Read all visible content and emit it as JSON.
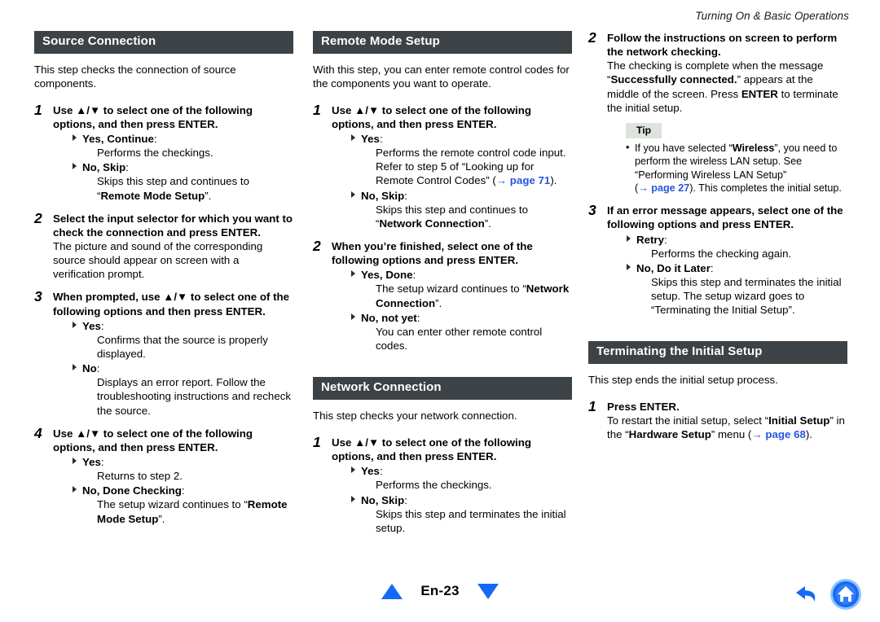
{
  "running_head": "Turning On & Basic Operations",
  "columns": [
    {
      "id": "column-1",
      "sections": [
        {
          "heading": "Source Connection",
          "intro": "This step checks the connection of source components.",
          "steps": [
            {
              "num": "1",
              "title": "Use ▲/▼ to select one of the following options, and then press ENTER.",
              "options": [
                {
                  "label": "Yes, Continue",
                  "desc": "Performs the checkings."
                },
                {
                  "label": "No, Skip",
                  "desc_pre": "Skips this step and continues to “",
                  "desc_bold": "Remote Mode Setup",
                  "desc_post": "”."
                }
              ]
            },
            {
              "num": "2",
              "title": "Select the input selector for which you want to check the connection and press ENTER.",
              "body": "The picture and sound of the corresponding source should appear on screen with a verification prompt."
            },
            {
              "num": "3",
              "title": "When prompted, use ▲/▼ to select one of the following options and then press ENTER.",
              "options": [
                {
                  "label": "Yes",
                  "desc": "Confirms that the source is properly displayed."
                },
                {
                  "label": "No",
                  "desc": "Displays an error report. Follow the troubleshooting instructions and recheck the source."
                }
              ]
            },
            {
              "num": "4",
              "title": "Use ▲/▼ to select one of the following options, and then press ENTER.",
              "options": [
                {
                  "label": "Yes",
                  "desc": "Returns to step 2."
                },
                {
                  "label": "No, Done Checking",
                  "desc_pre": "The setup wizard continues to “",
                  "desc_bold": "Remote Mode Setup",
                  "desc_post": "”."
                }
              ]
            }
          ]
        }
      ]
    },
    {
      "id": "column-2",
      "sections": [
        {
          "heading": "Remote Mode Setup",
          "intro": "With this step, you can enter remote control codes for the components you want to operate.",
          "steps": [
            {
              "num": "1",
              "title": "Use ▲/▼ to select one of the following options, and then press ENTER.",
              "options": [
                {
                  "label": "Yes",
                  "desc_pre": "Performs the remote control code input. Refer to step 5 of “Looking up for Remote Control Codes” (",
                  "link": "→ page 71",
                  "desc_post": ")."
                },
                {
                  "label": "No, Skip",
                  "desc_pre": "Skips this step and continues to “",
                  "desc_bold": "Network Connection",
                  "desc_post": "”."
                }
              ]
            },
            {
              "num": "2",
              "title": "When you’re finished, select one of the following options and press ENTER.",
              "options": [
                {
                  "label": "Yes, Done",
                  "desc_pre": "The setup wizard continues to “",
                  "desc_bold": "Network Connection",
                  "desc_post": "”."
                },
                {
                  "label": "No, not yet",
                  "desc": "You can enter other remote control codes."
                }
              ]
            }
          ]
        },
        {
          "heading": "Network Connection",
          "intro": "This step checks your network connection.",
          "steps": [
            {
              "num": "1",
              "title": "Use ▲/▼ to select one of the following options, and then press ENTER.",
              "options": [
                {
                  "label": "Yes",
                  "desc": "Performs the checkings."
                },
                {
                  "label": "No, Skip",
                  "desc": "Skips this step and terminates the initial setup."
                }
              ]
            }
          ]
        }
      ]
    },
    {
      "id": "column-3",
      "sections": [
        {
          "heading": null,
          "steps": [
            {
              "num": "2",
              "title": "Follow the instructions on screen to perform the network checking.",
              "body_pre": "The checking is complete when the message “",
              "body_bold_1": "Successfully connected.",
              "body_mid": "” appears at the middle of the screen. Press ",
              "body_bold_2": "ENTER",
              "body_post": " to terminate the initial setup.",
              "tip": {
                "badge": "Tip",
                "text_pre": "If you have selected “",
                "text_bold": "Wireless",
                "text_mid": "”, you need to perform the wireless LAN setup. See “Performing Wireless LAN Setup” (",
                "link": "→ page 27",
                "text_post": "). This completes the initial setup."
              }
            },
            {
              "num": "3",
              "title": "If an error message appears, select one of the following options and press ENTER.",
              "options": [
                {
                  "label": "Retry",
                  "desc": "Performs the checking again."
                },
                {
                  "label": "No, Do it Later",
                  "desc": "Skips this step and terminates the initial setup. The setup wizard goes to “Terminating the Initial Setup”."
                }
              ]
            }
          ]
        },
        {
          "heading": "Terminating the Initial Setup",
          "intro": "This step ends the initial setup process.",
          "steps": [
            {
              "num": "1",
              "title": "Press ENTER.",
              "body_pre": "To restart the initial setup, select “",
              "body_bold_1": "Initial Setup",
              "body_mid": "” in the “",
              "body_bold_2": "Hardware Setup",
              "body_mid_2": "” menu (",
              "link": "→ page 68",
              "body_post": ")."
            }
          ]
        }
      ]
    }
  ],
  "footer": {
    "page_label": "En-23",
    "prev_page_icon": "triangle-up-icon",
    "next_page_icon": "triangle-down-icon",
    "back_icon": "back-arrow-icon",
    "home_icon": "home-icon"
  },
  "colors": {
    "section_bar_bg": "#3c4245",
    "link_blue": "#2756e0",
    "tip_bg": "#dde3dd",
    "pager_blue": "#1569f5"
  }
}
